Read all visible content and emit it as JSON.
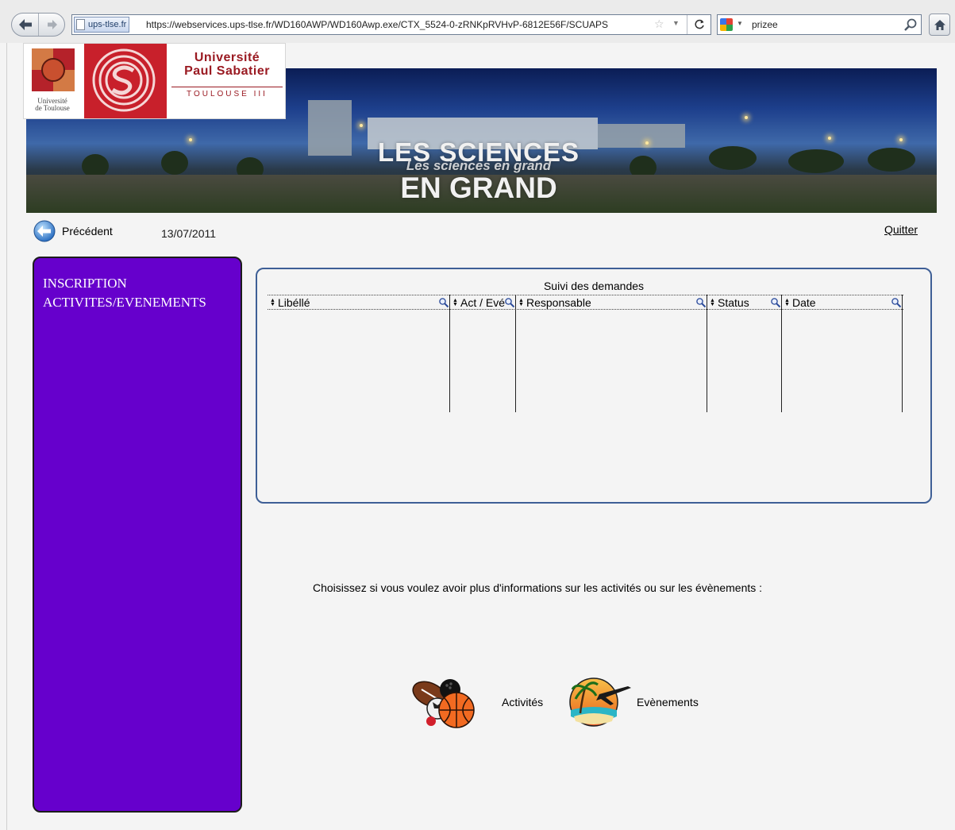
{
  "browser": {
    "site_identity": "ups-tlse.fr",
    "url": "https://webservices.ups-tlse.fr/WD160AWP/WD160Awp.exe/CTX_5524-0-zRNKpRVHvP-6812E56F/SCUAPS",
    "search_value": "prizee"
  },
  "header": {
    "logo_small_line1": "Université",
    "logo_small_line2": "de Toulouse",
    "logo_line1": "Université",
    "logo_line2": "Paul Sabatier",
    "logo_line3": "TOULOUSE III",
    "banner_line1": "LES SCIENCES",
    "banner_line2": "Les sciences en grand",
    "banner_line3": "EN GRAND"
  },
  "nav": {
    "previous_label": "Précédent",
    "date": "13/07/2011",
    "quit_label": "Quitter"
  },
  "sidebar": {
    "line1": "INSCRIPTION",
    "line2": "ACTIVITES/EVENEMENTS"
  },
  "tracking": {
    "title": "Suivi des demandes",
    "columns": [
      "Libéllé",
      "Act / Evé",
      "Responsable",
      "Status",
      "Date"
    ]
  },
  "choice": {
    "prompt": "Choisissez si vous voulez avoir plus d'informations sur les activités ou sur les évènements :",
    "activities_label": "Activités",
    "events_label": "Evènements"
  },
  "colors": {
    "sidebar_bg": "#6600cc",
    "panel_border": "#3e5f96",
    "university_red": "#c8202b"
  },
  "icons": {
    "back": "arrow-left-icon",
    "forward": "arrow-right-icon",
    "reload": "reload-icon",
    "home": "home-icon",
    "search": "magnifier-icon",
    "previous": "globe-back-icon",
    "activities": "sports-balls-icon",
    "events": "beach-plane-icon"
  }
}
